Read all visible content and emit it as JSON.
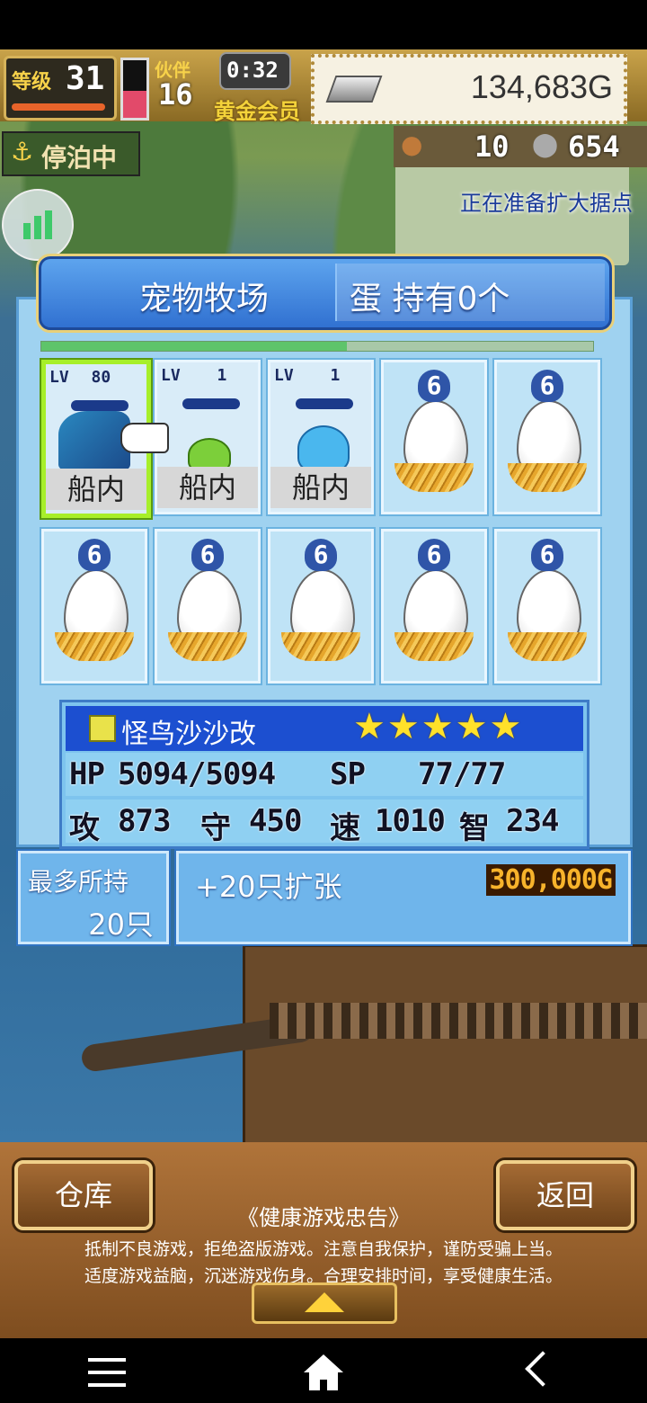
{
  "hud": {
    "level_label": "等级",
    "level": "31",
    "rank_label": "伙伴",
    "rank": "16",
    "timer": "0:32",
    "membership": "黄金会员",
    "gold": "134,683G",
    "status_badge": "停泊中",
    "counter_a": "10",
    "counter_b": "654",
    "notice": "正在准备扩大据点"
  },
  "panel": {
    "tab_title": "宠物牧场",
    "egg_count": "蛋 持有0个"
  },
  "slots": [
    {
      "type": "pet",
      "lv_label": "LV",
      "lv": "80",
      "label": "船内",
      "selected": true
    },
    {
      "type": "pet",
      "lv_label": "LV",
      "lv": "1",
      "label": "船内",
      "selected": false
    },
    {
      "type": "pet",
      "lv_label": "LV",
      "lv": "1",
      "label": "船内",
      "selected": false
    },
    {
      "type": "egg",
      "number": "6"
    },
    {
      "type": "egg",
      "number": "6"
    },
    {
      "type": "egg",
      "number": "6"
    },
    {
      "type": "egg",
      "number": "6"
    },
    {
      "type": "egg",
      "number": "6"
    },
    {
      "type": "egg",
      "number": "6"
    },
    {
      "type": "egg",
      "number": "6"
    }
  ],
  "pet_info": {
    "name": "怪鸟沙沙改",
    "stars": 5,
    "hp_label": "HP",
    "hp": "5094/5094",
    "sp_label": "SP",
    "sp": "77/77",
    "atk_label": "攻",
    "atk": "873",
    "def_label": "守",
    "def": "450",
    "spd_label": "速",
    "spd": "1010",
    "int_label": "智",
    "int": "234"
  },
  "capacity": {
    "label": "最多所持",
    "value": "20只",
    "expand_label": "+20只扩张",
    "expand_cost": "300,000G"
  },
  "bottom": {
    "warehouse": "仓库",
    "back": "返回",
    "advisory_title": "《健康游戏忠告》",
    "advisory_line1": "抵制不良游戏，拒绝盗版游戏。注意自我保护，谨防受骗上当。",
    "advisory_line2": "适度游戏益脑，沉迷游戏伤身。合理安排时间，享受健康生活。"
  },
  "colors": {
    "accent_blue": "#2f6fd0",
    "select_green": "#a7ef2a",
    "gold_text": "#f7b32b"
  }
}
